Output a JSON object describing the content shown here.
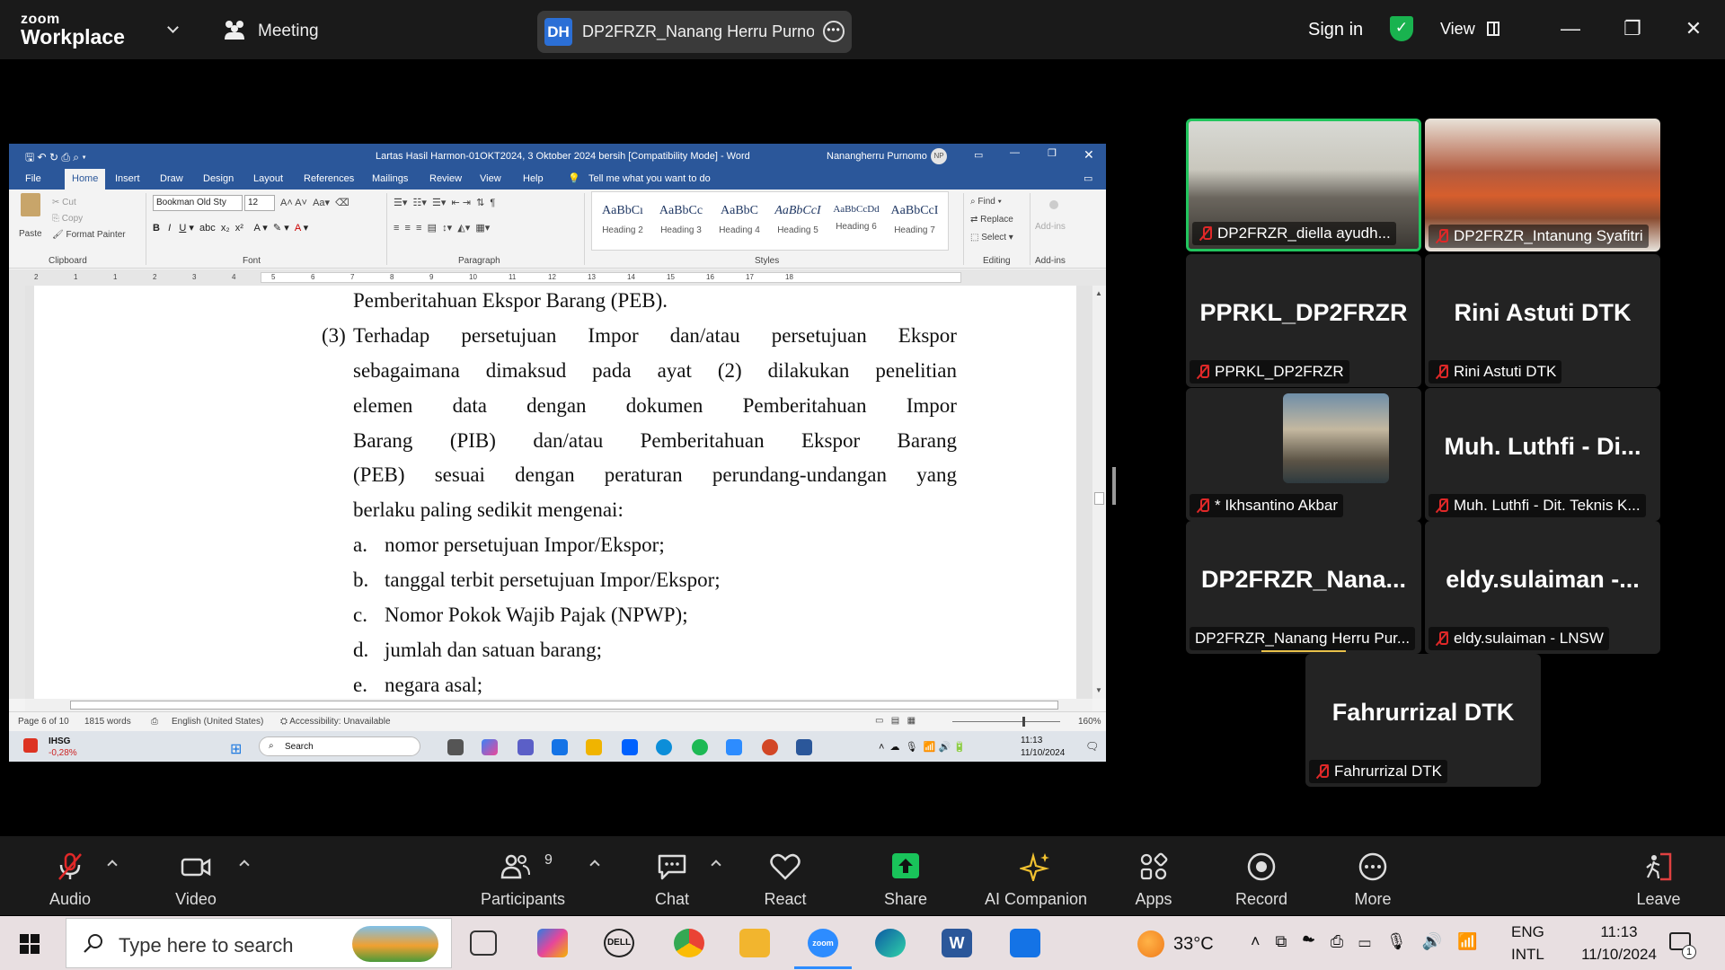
{
  "app": {
    "brand_line1": "zoom",
    "brand_line2": "Workplace",
    "meeting_label": "Meeting",
    "share_initials": "DH",
    "share_name": "DP2FRZR_Nanang Herru Purnomo",
    "sign_in": "Sign in",
    "view_label": "View"
  },
  "word": {
    "title": "Lartas Hasil Harmon-01OKT2024, 3 Oktober 2024 bersih [Compatibility Mode] - Word",
    "user": "Nanangherru Purnomo",
    "user_initials": "NP",
    "tabs": [
      "File",
      "Home",
      "Insert",
      "Draw",
      "Design",
      "Layout",
      "References",
      "Mailings",
      "Review",
      "View",
      "Help"
    ],
    "tell_me": "Tell me what you want to do",
    "clipboard": {
      "paste": "Paste",
      "cut": "Cut",
      "copy": "Copy",
      "format_painter": "Format Painter",
      "group": "Clipboard"
    },
    "font": {
      "name": "Bookman Old Sty",
      "size": "12",
      "group": "Font"
    },
    "paragraph_group": "Paragraph",
    "styles": [
      {
        "sample": "AaBbCı",
        "name": "Heading 2"
      },
      {
        "sample": "AaBbCc",
        "name": "Heading 3"
      },
      {
        "sample": "AaBbC",
        "name": "Heading 4"
      },
      {
        "sample": "AaBbCcI",
        "name": "Heading 5"
      },
      {
        "sample": "AaBbCcDd",
        "name": "Heading 6"
      },
      {
        "sample": "AaBbCcI",
        "name": "Heading 7"
      }
    ],
    "styles_group": "Styles",
    "editing": {
      "find": "Find",
      "replace": "Replace",
      "select": "Select",
      "group": "Editing"
    },
    "addins": {
      "label": "Add-ins",
      "group": "Add-ins"
    },
    "ruler_numbers": [
      "2",
      "1",
      "1",
      "2",
      "3",
      "4",
      "5",
      "6",
      "7",
      "8",
      "9",
      "10",
      "11",
      "12",
      "13",
      "14",
      "15",
      "16",
      "17",
      "18"
    ],
    "doc": {
      "line0": "Pemberitahuan Ekspor Barang (PEB).",
      "item3_num": "(3)",
      "line1": "Terhadap persetujuan Impor dan/atau persetujuan Ekspor",
      "line2": "sebagaimana dimaksud pada ayat (2) dilakukan penelitian",
      "line3": "elemen data dengan dokumen Pemberitahuan Impor",
      "line4": "Barang (PIB) dan/atau Pemberitahuan Ekspor Barang",
      "line5": "(PEB) sesuai dengan peraturan perundang-undangan yang",
      "line6": "berlaku paling sedikit mengenai:",
      "list": [
        {
          "m": "a.",
          "t": "nomor persetujuan Impor/Ekspor;"
        },
        {
          "m": "b.",
          "t": "tanggal terbit persetujuan Impor/Ekspor;"
        },
        {
          "m": "c.",
          "t": "Nomor Pokok Wajib Pajak (NPWP);"
        },
        {
          "m": "d.",
          "t": "jumlah dan satuan barang;"
        },
        {
          "m": "e.",
          "t": "negara asal;"
        }
      ]
    },
    "status": {
      "page": "Page 6 of 10",
      "words": "1815 words",
      "language": "English (United States)",
      "accessibility": "Accessibility: Unavailable",
      "zoom": "160%"
    },
    "taskbar": {
      "stock_name": "IHSG",
      "stock_change": "-0,28%",
      "search": "Search",
      "time": "11:13",
      "date": "11/10/2024"
    }
  },
  "participants": [
    {
      "name": "DP2FRZR_diella ayudh...",
      "big": "",
      "active": true
    },
    {
      "name": "DP2FRZR_Intanung Syafitri",
      "big": ""
    },
    {
      "name": "PPRKL_DP2FRZR",
      "big": "PPRKL_DP2FRZR"
    },
    {
      "name": "Rini Astuti DTK",
      "big": "Rini Astuti DTK"
    },
    {
      "name": "* Ikhsantino Akbar",
      "big": ""
    },
    {
      "name": "Muh. Luthfi - Dit. Teknis K...",
      "big": "Muh. Luthfi  - Di..."
    },
    {
      "name": "DP2FRZR_Nanang Herru Pur...",
      "big": "DP2FRZR_Nana..."
    },
    {
      "name": "eldy.sulaiman - LNSW",
      "big": "eldy.sulaiman  -..."
    },
    {
      "name": "Fahrurrizal DTK",
      "big": "Fahrurrizal DTK"
    }
  ],
  "toolbar": {
    "audio": "Audio",
    "video": "Video",
    "participants": "Participants",
    "participants_count": "9",
    "chat": "Chat",
    "react": "React",
    "share": "Share",
    "ai": "AI Companion",
    "apps": "Apps",
    "record": "Record",
    "more": "More",
    "leave": "Leave"
  },
  "windows": {
    "search_placeholder": "Type here to search",
    "weather": "33°C",
    "lang1": "ENG",
    "lang2": "INTL",
    "time": "11:13",
    "date": "11/10/2024",
    "notif_count": "1"
  },
  "colors": {
    "accent_green": "#22c55e",
    "word_blue": "#2b579a",
    "mute_red": "#e02828",
    "share_green": "#19c35a"
  }
}
